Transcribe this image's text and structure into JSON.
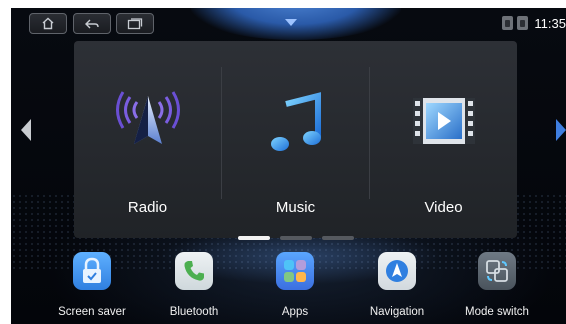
{
  "status_bar": {
    "buttons": [
      {
        "name": "home-button",
        "icon": "home-icon"
      },
      {
        "name": "back-button",
        "icon": "back-icon"
      },
      {
        "name": "recents-button",
        "icon": "recents-icon"
      }
    ],
    "pulldown_icon": "chevron-down-icon",
    "clock": "11:35"
  },
  "carousel": {
    "tiles": [
      {
        "label": "Radio",
        "icon": "radio-antenna-icon"
      },
      {
        "label": "Music",
        "icon": "music-note-icon"
      },
      {
        "label": "Video",
        "icon": "video-film-icon"
      }
    ],
    "page_count": 3,
    "active_page": 1
  },
  "dock": {
    "items": [
      {
        "label": "Screen saver",
        "icon": "lock-icon"
      },
      {
        "label": "Bluetooth",
        "icon": "phone-icon"
      },
      {
        "label": "Apps",
        "icon": "apps-grid-icon"
      },
      {
        "label": "Navigation",
        "icon": "navigation-icon"
      },
      {
        "label": "Mode switch",
        "icon": "mode-switch-icon"
      }
    ]
  },
  "colors": {
    "accent_blue": "#3f7ee0",
    "panel": "#2a2d32",
    "background": "#05070c"
  }
}
